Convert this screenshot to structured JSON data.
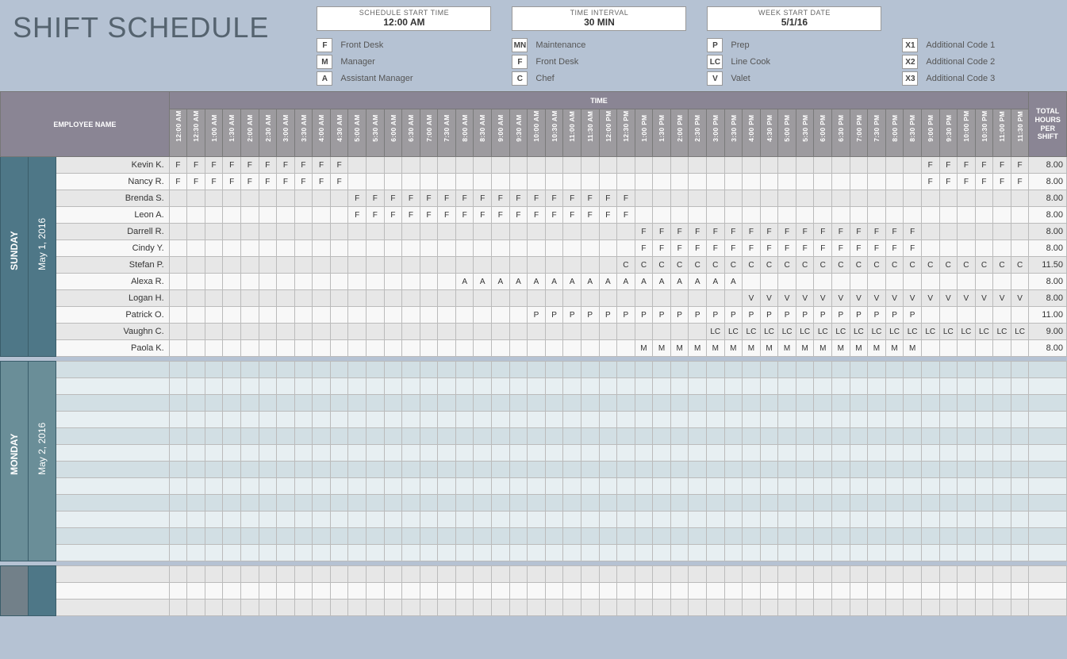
{
  "title": "SHIFT SCHEDULE",
  "params": [
    {
      "label": "SCHEDULE START TIME",
      "value": "12:00 AM"
    },
    {
      "label": "TIME INTERVAL",
      "value": "30 MIN"
    },
    {
      "label": "WEEK START DATE",
      "value": "5/1/16"
    }
  ],
  "legend": [
    [
      {
        "code": "F",
        "label": "Front Desk"
      },
      {
        "code": "M",
        "label": "Manager"
      },
      {
        "code": "A",
        "label": "Assistant Manager"
      }
    ],
    [
      {
        "code": "MN",
        "label": "Maintenance"
      },
      {
        "code": "F",
        "label": "Front Desk"
      },
      {
        "code": "C",
        "label": "Chef"
      }
    ],
    [
      {
        "code": "P",
        "label": "Prep"
      },
      {
        "code": "LC",
        "label": "Line Cook"
      },
      {
        "code": "V",
        "label": "Valet"
      }
    ],
    [
      {
        "code": "X1",
        "label": "Additional Code 1"
      },
      {
        "code": "X2",
        "label": "Additional Code 2"
      },
      {
        "code": "X3",
        "label": "Additional Code 3"
      }
    ]
  ],
  "headers": {
    "employee": "EMPLOYEE NAME",
    "time": "TIME",
    "total": "TOTAL HOURS PER SHIFT"
  },
  "time_slots": [
    "12:00 AM",
    "12:30 AM",
    "1:00 AM",
    "1:30 AM",
    "2:00 AM",
    "2:30 AM",
    "3:00 AM",
    "3:30 AM",
    "4:00 AM",
    "4:30 AM",
    "5:00 AM",
    "5:30 AM",
    "6:00 AM",
    "6:30 AM",
    "7:00 AM",
    "7:30 AM",
    "8:00 AM",
    "8:30 AM",
    "9:00 AM",
    "9:30 AM",
    "10:00 AM",
    "10:30 AM",
    "11:00 AM",
    "11:30 AM",
    "12:00 PM",
    "12:30 PM",
    "1:00 PM",
    "1:30 PM",
    "2:00 PM",
    "2:30 PM",
    "3:00 PM",
    "3:30 PM",
    "4:00 PM",
    "4:30 PM",
    "5:00 PM",
    "5:30 PM",
    "6:00 PM",
    "6:30 PM",
    "7:00 PM",
    "7:30 PM",
    "8:00 PM",
    "8:30 PM",
    "9:00 PM",
    "9:30 PM",
    "10:00 PM",
    "10:30 PM",
    "11:00 PM",
    "11:30 PM"
  ],
  "days": [
    {
      "name": "SUNDAY",
      "date": "May 1, 2016",
      "css": "sunday",
      "rows": [
        {
          "emp": "Kevin K.",
          "total": "8.00",
          "slots": {
            "0": "F",
            "1": "F",
            "2": "F",
            "3": "F",
            "4": "F",
            "5": "F",
            "6": "F",
            "7": "F",
            "8": "F",
            "9": "F",
            "42": "F",
            "43": "F",
            "44": "F",
            "45": "F",
            "46": "F",
            "47": "F"
          }
        },
        {
          "emp": "Nancy R.",
          "total": "8.00",
          "slots": {
            "0": "F",
            "1": "F",
            "2": "F",
            "3": "F",
            "4": "F",
            "5": "F",
            "6": "F",
            "7": "F",
            "8": "F",
            "9": "F",
            "42": "F",
            "43": "F",
            "44": "F",
            "45": "F",
            "46": "F",
            "47": "F"
          }
        },
        {
          "emp": "Brenda S.",
          "total": "8.00",
          "slots": {
            "10": "F",
            "11": "F",
            "12": "F",
            "13": "F",
            "14": "F",
            "15": "F",
            "16": "F",
            "17": "F",
            "18": "F",
            "19": "F",
            "20": "F",
            "21": "F",
            "22": "F",
            "23": "F",
            "24": "F",
            "25": "F"
          }
        },
        {
          "emp": "Leon A.",
          "total": "8.00",
          "slots": {
            "10": "F",
            "11": "F",
            "12": "F",
            "13": "F",
            "14": "F",
            "15": "F",
            "16": "F",
            "17": "F",
            "18": "F",
            "19": "F",
            "20": "F",
            "21": "F",
            "22": "F",
            "23": "F",
            "24": "F",
            "25": "F"
          }
        },
        {
          "emp": "Darrell R.",
          "total": "8.00",
          "slots": {
            "26": "F",
            "27": "F",
            "28": "F",
            "29": "F",
            "30": "F",
            "31": "F",
            "32": "F",
            "33": "F",
            "34": "F",
            "35": "F",
            "36": "F",
            "37": "F",
            "38": "F",
            "39": "F",
            "40": "F",
            "41": "F"
          }
        },
        {
          "emp": "Cindy Y.",
          "total": "8.00",
          "slots": {
            "26": "F",
            "27": "F",
            "28": "F",
            "29": "F",
            "30": "F",
            "31": "F",
            "32": "F",
            "33": "F",
            "34": "F",
            "35": "F",
            "36": "F",
            "37": "F",
            "38": "F",
            "39": "F",
            "40": "F",
            "41": "F"
          }
        },
        {
          "emp": "Stefan P.",
          "total": "11.50",
          "slots": {
            "25": "C",
            "26": "C",
            "27": "C",
            "28": "C",
            "29": "C",
            "30": "C",
            "31": "C",
            "32": "C",
            "33": "C",
            "34": "C",
            "35": "C",
            "36": "C",
            "37": "C",
            "38": "C",
            "39": "C",
            "40": "C",
            "41": "C",
            "42": "C",
            "43": "C",
            "44": "C",
            "45": "C",
            "46": "C",
            "47": "C"
          }
        },
        {
          "emp": "Alexa R.",
          "total": "8.00",
          "slots": {
            "16": "A",
            "17": "A",
            "18": "A",
            "19": "A",
            "20": "A",
            "21": "A",
            "22": "A",
            "23": "A",
            "24": "A",
            "25": "A",
            "26": "A",
            "27": "A",
            "28": "A",
            "29": "A",
            "30": "A",
            "31": "A"
          }
        },
        {
          "emp": "Logan H.",
          "total": "8.00",
          "slots": {
            "32": "V",
            "33": "V",
            "34": "V",
            "35": "V",
            "36": "V",
            "37": "V",
            "38": "V",
            "39": "V",
            "40": "V",
            "41": "V",
            "42": "V",
            "43": "V",
            "44": "V",
            "45": "V",
            "46": "V",
            "47": "V"
          }
        },
        {
          "emp": "Patrick O.",
          "total": "11.00",
          "slots": {
            "20": "P",
            "21": "P",
            "22": "P",
            "23": "P",
            "24": "P",
            "25": "P",
            "26": "P",
            "27": "P",
            "28": "P",
            "29": "P",
            "30": "P",
            "31": "P",
            "32": "P",
            "33": "P",
            "34": "P",
            "35": "P",
            "36": "P",
            "37": "P",
            "38": "P",
            "39": "P",
            "40": "P",
            "41": "P"
          }
        },
        {
          "emp": "Vaughn C.",
          "total": "9.00",
          "slots": {
            "30": "LC",
            "31": "LC",
            "32": "LC",
            "33": "LC",
            "34": "LC",
            "35": "LC",
            "36": "LC",
            "37": "LC",
            "38": "LC",
            "39": "LC",
            "40": "LC",
            "41": "LC",
            "42": "LC",
            "43": "LC",
            "44": "LC",
            "45": "LC",
            "46": "LC",
            "47": "LC"
          }
        },
        {
          "emp": "Paola K.",
          "total": "8.00",
          "slots": {
            "26": "M",
            "27": "M",
            "28": "M",
            "29": "M",
            "30": "M",
            "31": "M",
            "32": "M",
            "33": "M",
            "34": "M",
            "35": "M",
            "36": "M",
            "37": "M",
            "38": "M",
            "39": "M",
            "40": "M",
            "41": "M"
          }
        }
      ]
    },
    {
      "name": "MONDAY",
      "date": "May 2, 2016",
      "css": "monday",
      "rows": [
        {
          "emp": "",
          "total": "",
          "slots": {}
        },
        {
          "emp": "",
          "total": "",
          "slots": {}
        },
        {
          "emp": "",
          "total": "",
          "slots": {}
        },
        {
          "emp": "",
          "total": "",
          "slots": {}
        },
        {
          "emp": "",
          "total": "",
          "slots": {}
        },
        {
          "emp": "",
          "total": "",
          "slots": {}
        },
        {
          "emp": "",
          "total": "",
          "slots": {}
        },
        {
          "emp": "",
          "total": "",
          "slots": {}
        },
        {
          "emp": "",
          "total": "",
          "slots": {}
        },
        {
          "emp": "",
          "total": "",
          "slots": {}
        },
        {
          "emp": "",
          "total": "",
          "slots": {}
        },
        {
          "emp": "",
          "total": "",
          "slots": {}
        }
      ]
    },
    {
      "name": "",
      "date": "",
      "css": "tiny",
      "rows": [
        {
          "emp": "",
          "total": "",
          "slots": {}
        },
        {
          "emp": "",
          "total": "",
          "slots": {}
        },
        {
          "emp": "",
          "total": "",
          "slots": {}
        }
      ]
    }
  ]
}
